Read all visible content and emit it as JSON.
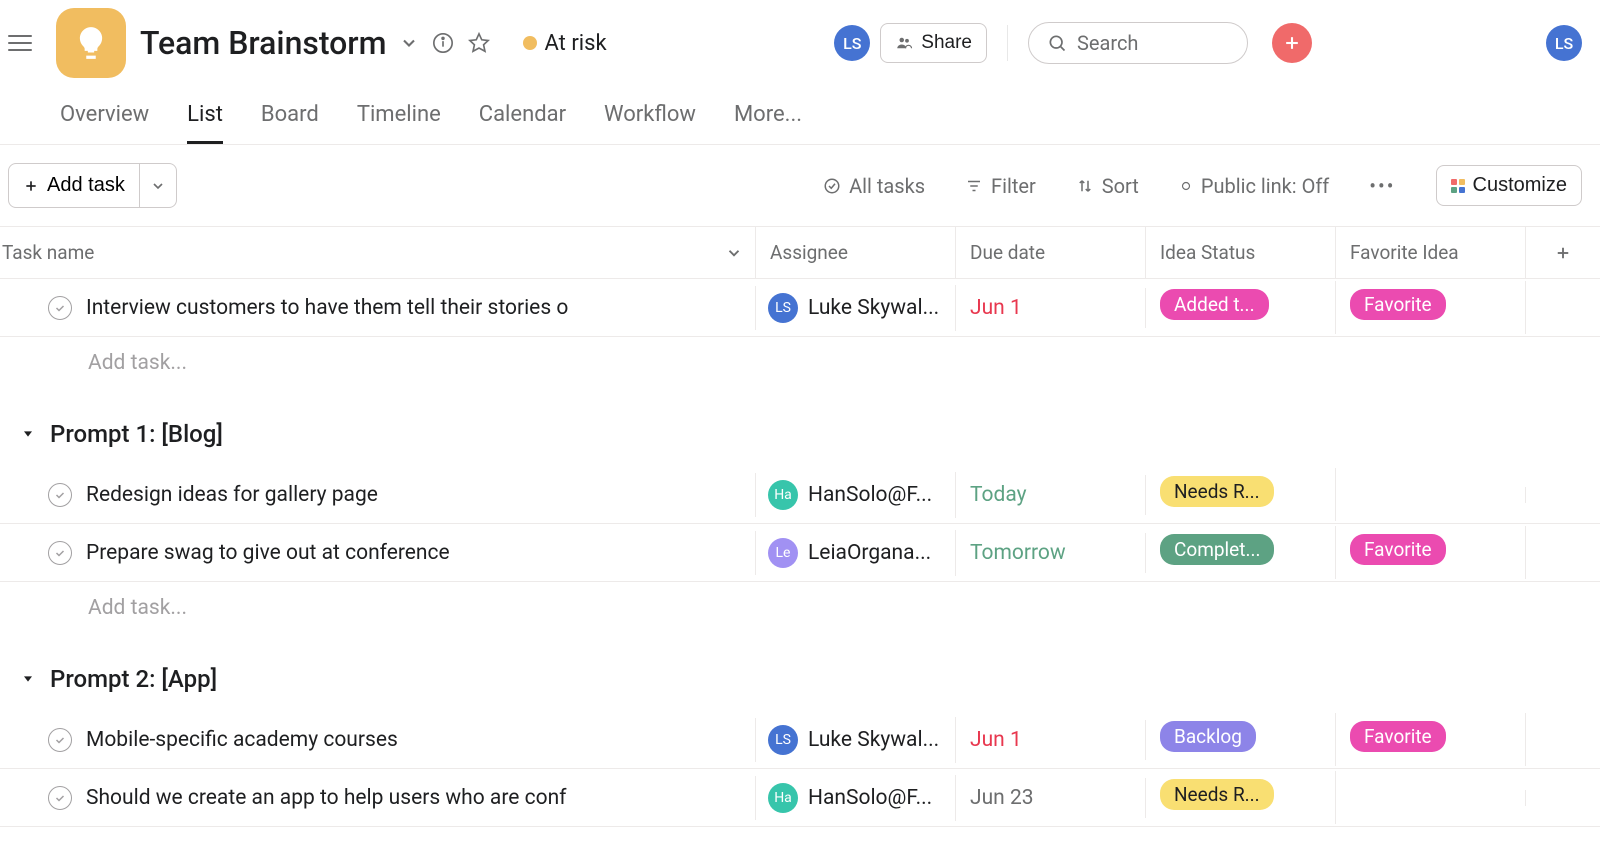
{
  "header": {
    "project_title": "Team Brainstorm",
    "status_text": "At risk",
    "share_label": "Share",
    "search_placeholder": "Search",
    "user_initials": "LS"
  },
  "tabs": {
    "overview": "Overview",
    "list": "List",
    "board": "Board",
    "timeline": "Timeline",
    "calendar": "Calendar",
    "workflow": "Workflow",
    "more": "More..."
  },
  "toolbar": {
    "add_task": "Add task",
    "all_tasks": "All tasks",
    "filter": "Filter",
    "sort": "Sort",
    "public_link": "Public link: Off",
    "customize": "Customize"
  },
  "columns": {
    "task": "Task name",
    "assignee": "Assignee",
    "due": "Due date",
    "idea": "Idea Status",
    "fav": "Favorite Idea"
  },
  "add_task_placeholder": "Add task...",
  "sections": [
    {
      "title": null,
      "tasks": [
        {
          "name": "Interview customers to have them tell their stories o",
          "assignee": {
            "label": "Luke Skywal...",
            "initials": "LS",
            "avatar_class": "av-ls"
          },
          "due": {
            "text": "Jun 1",
            "class": "due-red"
          },
          "idea": {
            "text": "Added t...",
            "class": "pill-magenta"
          },
          "fav": {
            "text": "Favorite",
            "class": "pill-magenta"
          }
        }
      ]
    },
    {
      "title": "Prompt 1: [Blog]",
      "tasks": [
        {
          "name": "Redesign ideas for gallery page",
          "assignee": {
            "label": "HanSolo@F...",
            "initials": "Ha",
            "avatar_class": "av-ha"
          },
          "due": {
            "text": "Today",
            "class": "due-green"
          },
          "idea": {
            "text": "Needs R...",
            "class": "pill-yellow"
          },
          "fav": null
        },
        {
          "name": "Prepare swag to give out at conference",
          "assignee": {
            "label": "LeiaOrgana...",
            "initials": "Le",
            "avatar_class": "av-le"
          },
          "due": {
            "text": "Tomorrow",
            "class": "due-green"
          },
          "idea": {
            "text": "Complet...",
            "class": "pill-green"
          },
          "fav": {
            "text": "Favorite",
            "class": "pill-magenta"
          }
        }
      ]
    },
    {
      "title": "Prompt 2: [App]",
      "tasks": [
        {
          "name": "Mobile-specific academy courses",
          "assignee": {
            "label": "Luke Skywal...",
            "initials": "LS",
            "avatar_class": "av-ls"
          },
          "due": {
            "text": "Jun 1",
            "class": "due-red"
          },
          "idea": {
            "text": "Backlog",
            "class": "pill-purple"
          },
          "fav": {
            "text": "Favorite",
            "class": "pill-magenta"
          }
        },
        {
          "name": "Should we create an app to help users who are conf",
          "assignee": {
            "label": "HanSolo@F...",
            "initials": "Ha",
            "avatar_class": "av-ha"
          },
          "due": {
            "text": "Jun 23",
            "class": "due-grey"
          },
          "idea": {
            "text": "Needs R...",
            "class": "pill-yellow"
          },
          "fav": null
        }
      ]
    }
  ]
}
